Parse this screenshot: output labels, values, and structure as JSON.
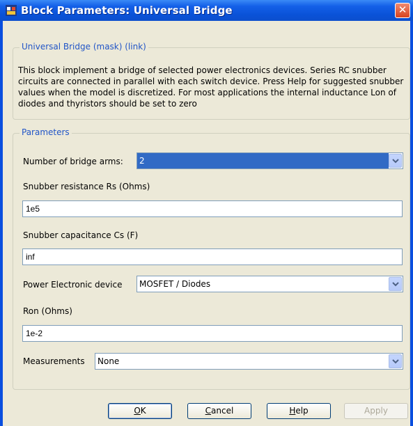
{
  "window": {
    "title": "Block Parameters: Universal Bridge",
    "close_glyph": "✕"
  },
  "mask_group": {
    "legend": "Universal Bridge (mask) (link)",
    "description": "This block implement a bridge of selected power electronics devices.  Series RC snubber circuits are connected in parallel with each switch device.  Press Help for suggested snubber values when the model is discretized. For most applications the internal inductance Lon of diodes and thyristors should be set to zero"
  },
  "parameters": {
    "legend": "Parameters",
    "bridge_arms": {
      "label": "Number of bridge arms:",
      "value": "2"
    },
    "snubber_resistance": {
      "label": "Snubber resistance Rs (Ohms)",
      "value": "1e5"
    },
    "snubber_capacitance": {
      "label": "Snubber capacitance Cs (F)",
      "value": "inf"
    },
    "device": {
      "label": "Power Electronic device",
      "value": "MOSFET / Diodes"
    },
    "ron": {
      "label": "Ron (Ohms)",
      "value": "1e-2"
    },
    "measurements": {
      "label": "Measurements",
      "value": "None"
    }
  },
  "buttons": {
    "ok": {
      "key": "O",
      "rest": "K"
    },
    "cancel": {
      "key": "C",
      "rest": "ancel"
    },
    "help": {
      "key": "H",
      "rest": "elp"
    },
    "apply": "Apply"
  },
  "colors": {
    "titlebar": "#0a52d8",
    "client": "#ece9d8",
    "legend_text": "#2155c7",
    "selection": "#316ac5"
  }
}
